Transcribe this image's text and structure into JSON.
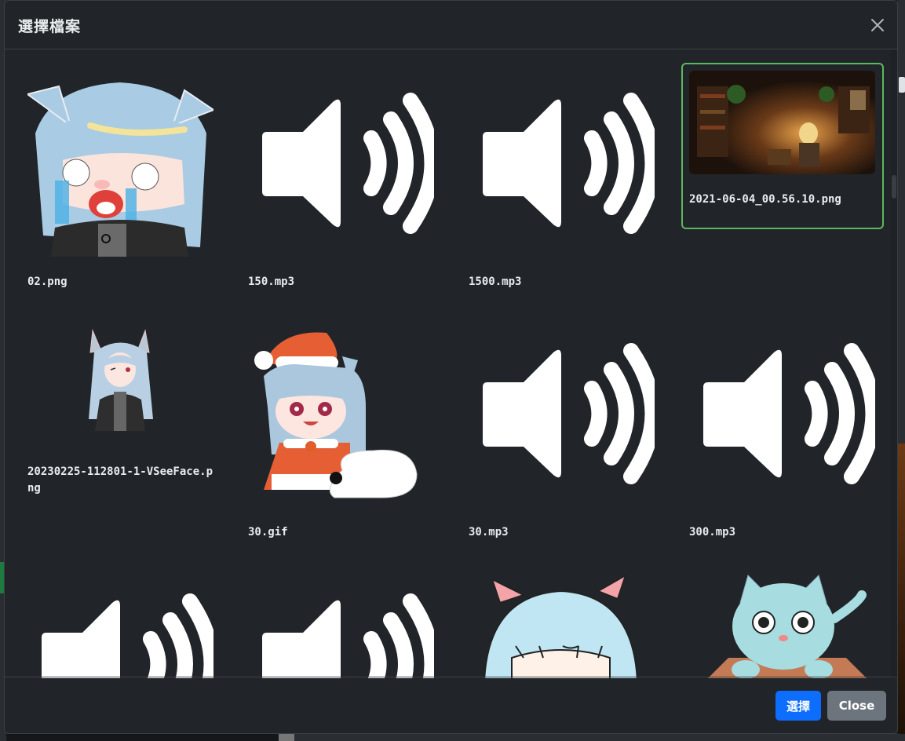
{
  "modal": {
    "title": "選擇檔案",
    "close_icon": "close-icon"
  },
  "files": [
    {
      "name": "02.png",
      "kind": "image-avatar-crying"
    },
    {
      "name": "150.mp3",
      "kind": "audio"
    },
    {
      "name": "1500.mp3",
      "kind": "audio"
    },
    {
      "name": "2021-06-04_00.56.10.png",
      "kind": "image-library-scene",
      "selected": true
    },
    {
      "name": "20230225-112801-1-VSeeFace.png",
      "kind": "image-avatar-small"
    },
    {
      "name": "30.gif",
      "kind": "image-santa-avatar"
    },
    {
      "name": "30.mp3",
      "kind": "audio"
    },
    {
      "name": "300.mp3",
      "kind": "audio"
    },
    {
      "name": "",
      "kind": "audio"
    },
    {
      "name": "",
      "kind": "audio"
    },
    {
      "name": "",
      "kind": "image-avatar-face"
    },
    {
      "name": "",
      "kind": "image-cat-box"
    }
  ],
  "footer": {
    "select_label": "選擇",
    "close_label": "Close"
  },
  "colors": {
    "modal_bg": "#212529",
    "selected_border": "#5cb85c",
    "primary": "#0d6efd",
    "secondary": "#6c757d"
  }
}
